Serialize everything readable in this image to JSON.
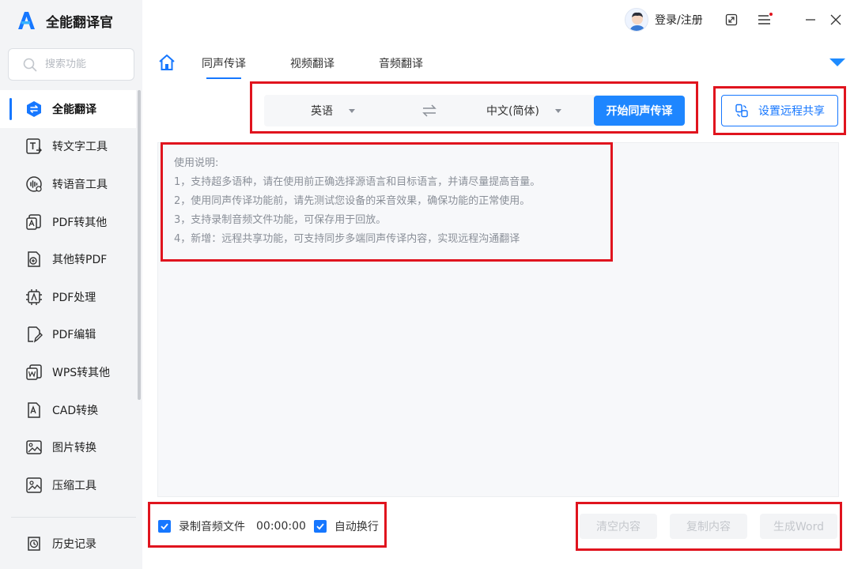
{
  "app": {
    "title": "全能翻译官"
  },
  "search": {
    "placeholder": "搜索功能"
  },
  "sidebar": {
    "items": [
      {
        "label": "全能翻译",
        "icon": "translate-icon",
        "active": true
      },
      {
        "label": "转文字工具",
        "icon": "text-tool-icon"
      },
      {
        "label": "转语音工具",
        "icon": "voice-tool-icon"
      },
      {
        "label": "PDF转其他",
        "icon": "pdf-convert-icon"
      },
      {
        "label": "其他转PDF",
        "icon": "to-pdf-icon"
      },
      {
        "label": "PDF处理",
        "icon": "pdf-process-icon"
      },
      {
        "label": "PDF编辑",
        "icon": "pdf-edit-icon"
      },
      {
        "label": "WPS转其他",
        "icon": "wps-convert-icon"
      },
      {
        "label": "CAD转换",
        "icon": "cad-convert-icon"
      },
      {
        "label": "图片转换",
        "icon": "image-convert-icon"
      },
      {
        "label": "压缩工具",
        "icon": "compress-icon"
      }
    ],
    "history": "历史记录"
  },
  "header": {
    "login_label": "登录/注册"
  },
  "tabs": [
    {
      "label": "同声传译",
      "active": true
    },
    {
      "label": "视频翻译"
    },
    {
      "label": "音频翻译"
    }
  ],
  "translator": {
    "source_lang": "英语",
    "target_lang": "中文(简体)",
    "start_button": "开始同声传译",
    "remote_button": "设置远程共享"
  },
  "instructions": {
    "title": "使用说明:",
    "lines": [
      "1，支持超多语种，请在使用前正确选择源语言和目标语言，并请尽量提高音量。",
      "2，使用同声传译功能前，请先测试您设备的采音效果，确保功能的正常使用。",
      "3，支持录制音频文件功能，可保存用于回放。",
      "4，新增：远程共享功能，可支持同步多端同声传译内容，实现远程沟通翻译"
    ]
  },
  "bottom": {
    "record_label": "录制音频文件",
    "record_checked": true,
    "timer": "00:00:00",
    "autowrap_label": "自动换行",
    "autowrap_checked": true,
    "clear_button": "清空内容",
    "copy_button": "复制内容",
    "word_button": "生成Word"
  },
  "colors": {
    "accent": "#1677ff",
    "button": "#1e86ff",
    "annotation": "#e0141e",
    "notification": "#e0141e"
  }
}
